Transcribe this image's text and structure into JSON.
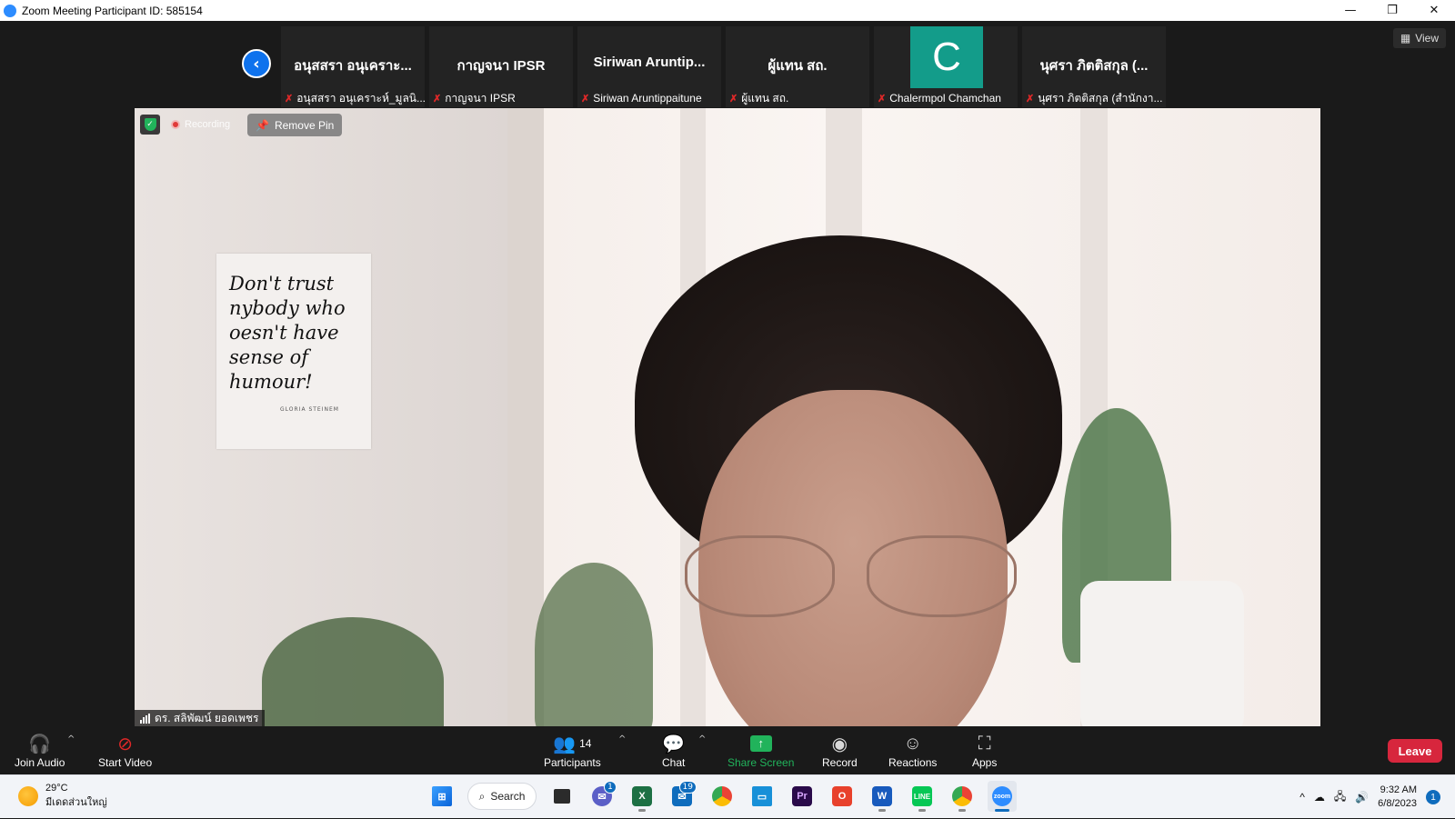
{
  "window": {
    "title": "Zoom Meeting Participant ID: 585154",
    "controls": {
      "minimize": "—",
      "restore": "❐",
      "close": "✕"
    }
  },
  "view_button": {
    "label": "View"
  },
  "gallery": {
    "tiles": [
      {
        "display_name": "อนุสสรา อนุเคราะ...",
        "label": "อนุสสรา อนุเคราะห์_มูลนิ..."
      },
      {
        "display_name": "กาญจนา IPSR",
        "label": "กาญจนา IPSR"
      },
      {
        "display_name": "Siriwan  Aruntip...",
        "label": "Siriwan Aruntippaitune"
      },
      {
        "display_name": "ผู้แทน สถ.",
        "label": "ผู้แทน สถ."
      },
      {
        "display_name": "",
        "avatar_letter": "C",
        "label": "Chalermpol Chamchan"
      },
      {
        "display_name": "นุศรา  ภิตติสกุล (...",
        "label": "นุศรา  ภิตติสกุล (สำนักงา..."
      }
    ]
  },
  "video": {
    "recording_label": "Recording",
    "remove_pin_label": "Remove Pin",
    "active_speaker_name": "ดร. สลิพัฒน์ ยอดเพชร",
    "poster_lines": [
      "Don't trust",
      "nybody who",
      "oesn't have",
      "sense of",
      "humour!"
    ],
    "poster_signature": "GLORIA STEINEM"
  },
  "toolbar": {
    "join_audio": "Join Audio",
    "start_video": "Start Video",
    "participants": "Participants",
    "participant_count": "14",
    "chat": "Chat",
    "share_screen": "Share Screen",
    "record": "Record",
    "reactions": "Reactions",
    "apps": "Apps",
    "leave": "Leave"
  },
  "taskbar": {
    "weather_temp": "29°C",
    "weather_desc": "มีเดดส่วนใหญ่",
    "search_label": "Search",
    "chat_badge": "1",
    "mail_badge": "19",
    "time": "9:32 AM",
    "date": "6/8/2023",
    "notification_count": "1"
  },
  "colors": {
    "zoom_blue": "#0e72ed",
    "leave_red": "#d7263d",
    "share_green": "#21b35b",
    "avatar_teal": "#139c8a"
  }
}
